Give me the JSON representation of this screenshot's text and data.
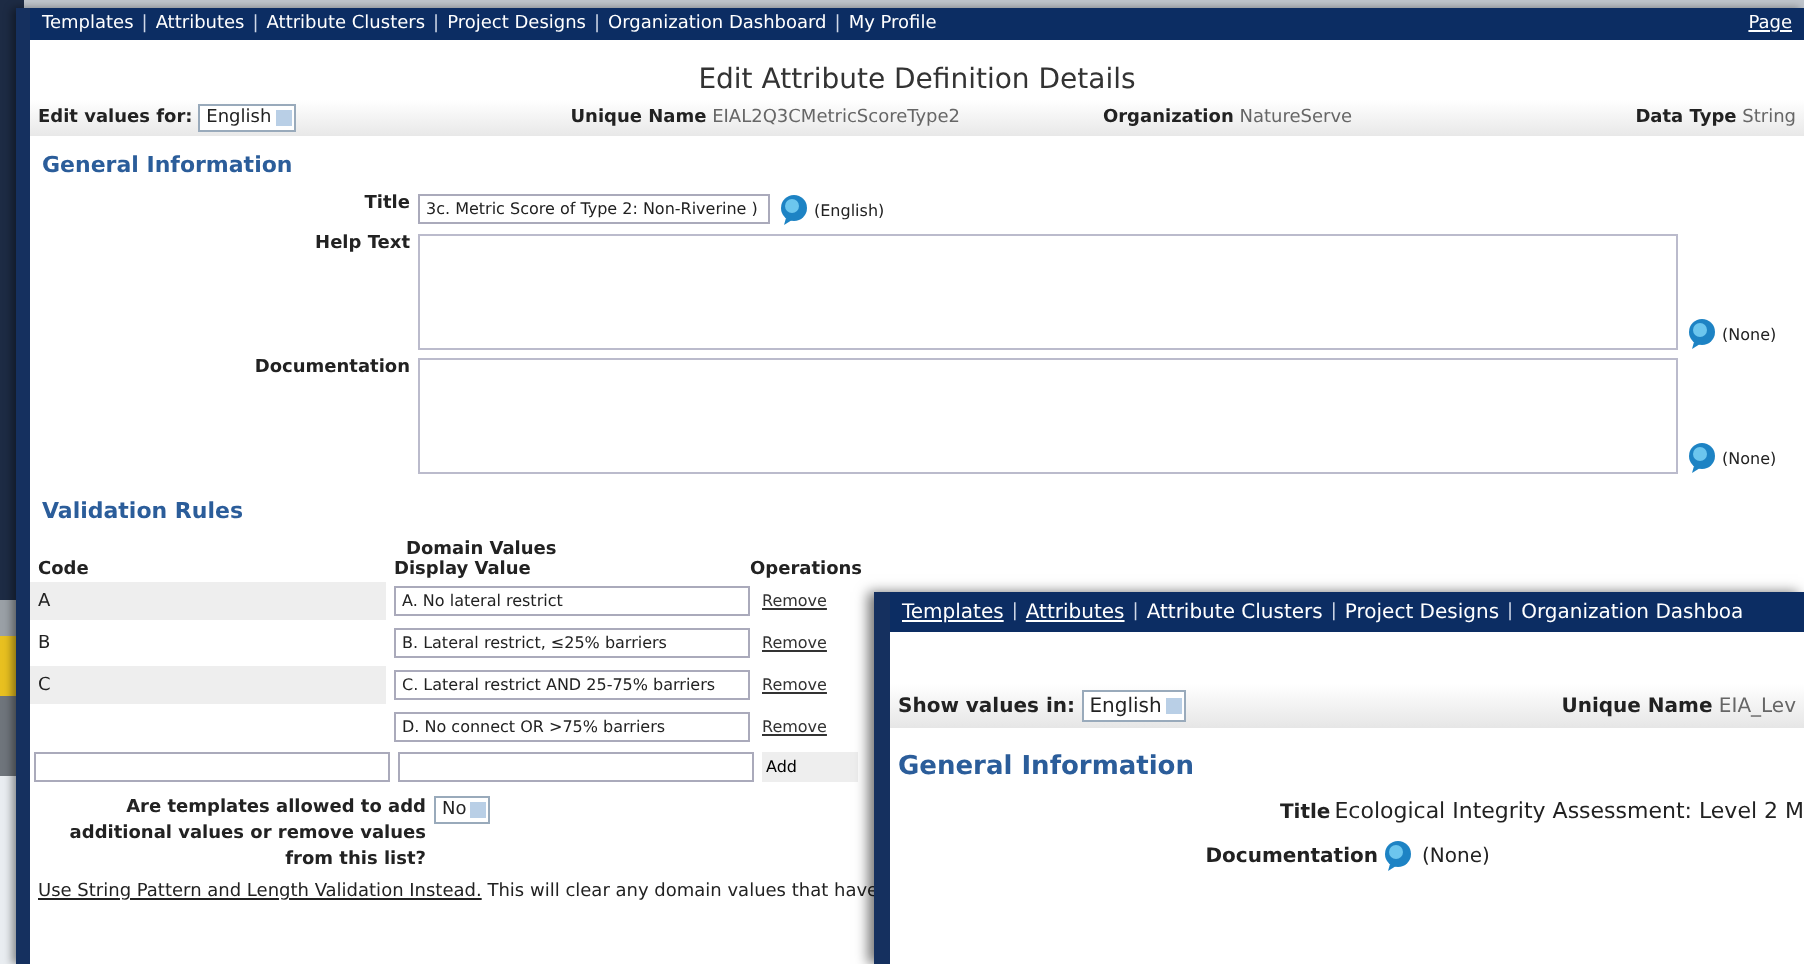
{
  "main": {
    "nav": [
      {
        "label": "Templates",
        "underlined": false
      },
      {
        "label": "Attributes",
        "underlined": false
      },
      {
        "label": "Attribute Clusters",
        "underlined": false
      },
      {
        "label": "Project Designs",
        "underlined": false
      },
      {
        "label": "Organization Dashboard",
        "underlined": false
      },
      {
        "label": "My Profile",
        "underlined": false
      }
    ],
    "separator": "|",
    "nav_right": "Page",
    "title": "Edit Attribute Definition Details",
    "language_label": "Edit values for:",
    "language": "English",
    "meta": [
      {
        "label": "Unique Name",
        "value": "EIAL2Q3CMetricScoreType2"
      },
      {
        "label": "Organization",
        "value": "NatureServe"
      },
      {
        "label": "Data Type",
        "value": "String"
      }
    ],
    "general_heading": "General Information",
    "fields": [
      {
        "kind": "input",
        "label": "Title",
        "value": "3c. Metric Score of Type 2: Non-Riverine )",
        "note": "(English)"
      },
      {
        "kind": "textarea",
        "label": "Help Text",
        "note": "(None)"
      },
      {
        "kind": "textarea",
        "label": "Documentation",
        "note": "(None)"
      }
    ],
    "validation_heading": "Validation Rules",
    "domain_heading": "Domain Values",
    "columns": [
      "Code",
      "Display Value",
      "Operations"
    ],
    "rows": [
      {
        "code": "A",
        "display": "A. No lateral restrict",
        "action": "Remove"
      },
      {
        "code": "B",
        "display": "B. Lateral restrict, ≤25% barriers",
        "action": "Remove"
      },
      {
        "code": "C",
        "display": "C. Lateral restrict AND 25-75% barriers",
        "action": "Remove"
      },
      {
        "display": "D. No connect OR >75% barriers",
        "action": "Remove"
      }
    ],
    "add_label": "Add",
    "question": "Are templates allowed to add additional values or remove values from this list?",
    "answer": "No",
    "footer_link": "Use String Pattern and Length Validation Instead.",
    "footer_text": "This will clear any domain values that have"
  },
  "second": {
    "nav": [
      {
        "label": "Templates",
        "underlined": true
      },
      {
        "label": "Attributes",
        "underlined": true
      },
      {
        "label": "Attribute Clusters",
        "underlined": false
      },
      {
        "label": "Project Designs",
        "underlined": false
      },
      {
        "label": "Organization Dashboa",
        "underlined": false
      }
    ],
    "separator": "|",
    "language_label": "Show values in:",
    "language": "English",
    "unique_label": "Unique Name",
    "unique_value": "EIA_Lev",
    "general_heading": "General Information",
    "title_label": "Title",
    "title_value": "Ecological Integrity Assessment: Level 2 M",
    "doc_label": "Documentation",
    "doc_note": "(None)"
  }
}
